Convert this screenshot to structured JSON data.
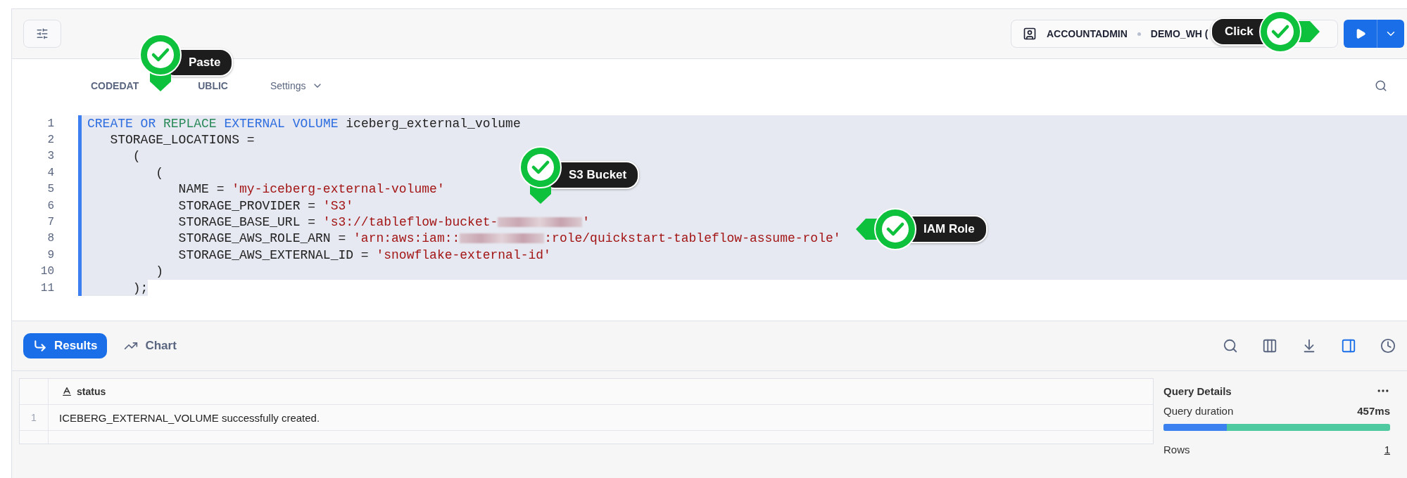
{
  "toolbar": {
    "role": "ACCOUNTADMIN",
    "warehouse": "DEMO_WH ("
  },
  "editor_tabs": {
    "breadcrumb_start": "CODEDAT",
    "breadcrumb_end": "UBLIC",
    "settings": "Settings"
  },
  "code": [
    {
      "number": "1",
      "highlighted": true,
      "tokens": [
        {
          "kind": "keyword",
          "text": "CREATE OR "
        },
        {
          "kind": "keyword2",
          "text": "REPLACE"
        },
        {
          "kind": "keyword",
          "text": " EXTERNAL VOLUME"
        },
        {
          "kind": "plain",
          "text": " iceberg_external_volume"
        }
      ]
    },
    {
      "number": "2",
      "highlighted": true,
      "tokens": [
        {
          "kind": "plain",
          "text": "   STORAGE_LOCATIONS ="
        }
      ]
    },
    {
      "number": "3",
      "highlighted": true,
      "tokens": [
        {
          "kind": "plain",
          "text": "      ("
        }
      ]
    },
    {
      "number": "4",
      "highlighted": true,
      "tokens": [
        {
          "kind": "plain",
          "text": "         ("
        }
      ]
    },
    {
      "number": "5",
      "highlighted": true,
      "tokens": [
        {
          "kind": "plain",
          "text": "            NAME = "
        },
        {
          "kind": "string",
          "text": "'my-iceberg-external-volume'"
        }
      ]
    },
    {
      "number": "6",
      "highlighted": true,
      "tokens": [
        {
          "kind": "plain",
          "text": "            STORAGE_PROVIDER = "
        },
        {
          "kind": "string",
          "text": "'S3'"
        }
      ]
    },
    {
      "number": "7",
      "highlighted": true,
      "tokens": [
        {
          "kind": "plain",
          "text": "            STORAGE_BASE_URL = "
        },
        {
          "kind": "string",
          "text": "'s3://tableflow-bucket-"
        },
        {
          "kind": "redacted"
        },
        {
          "kind": "string",
          "text": "'"
        }
      ]
    },
    {
      "number": "8",
      "highlighted": true,
      "tokens": [
        {
          "kind": "plain",
          "text": "            STORAGE_AWS_ROLE_ARN = "
        },
        {
          "kind": "string",
          "text": "'arn:aws:iam::"
        },
        {
          "kind": "redacted"
        },
        {
          "kind": "string",
          "text": ":role/quickstart-tableflow-assume-role'"
        }
      ]
    },
    {
      "number": "9",
      "highlighted": true,
      "tokens": [
        {
          "kind": "plain",
          "text": "            STORAGE_AWS_EXTERNAL_ID = "
        },
        {
          "kind": "string",
          "text": "'snowflake-external-id'"
        }
      ]
    },
    {
      "number": "10",
      "highlighted": true,
      "tokens": [
        {
          "kind": "plain",
          "text": "         )"
        }
      ]
    },
    {
      "number": "11",
      "highlighted": false,
      "tokens": [
        {
          "kind": "plain",
          "text": "      );"
        }
      ]
    }
  ],
  "annotations": [
    {
      "kind": "down",
      "label": "Paste"
    },
    {
      "kind": "right",
      "label": "Click"
    },
    {
      "kind": "down",
      "label": "S3 Bucket"
    },
    {
      "kind": "left",
      "label": "IAM Role"
    }
  ],
  "result_tabs": [
    {
      "label": "Results",
      "selected": true
    },
    {
      "label": "Chart",
      "selected": false
    }
  ],
  "table": {
    "columns": [
      "status"
    ],
    "rows": [
      {
        "number": "1",
        "cells": [
          "ICEBERG_EXTERNAL_VOLUME successfully created."
        ]
      }
    ]
  },
  "query_details": {
    "title": "Query Details",
    "duration_label": "Query duration",
    "duration": "457ms",
    "level": 0.28,
    "rows_label": "Rows",
    "rows": "1"
  }
}
